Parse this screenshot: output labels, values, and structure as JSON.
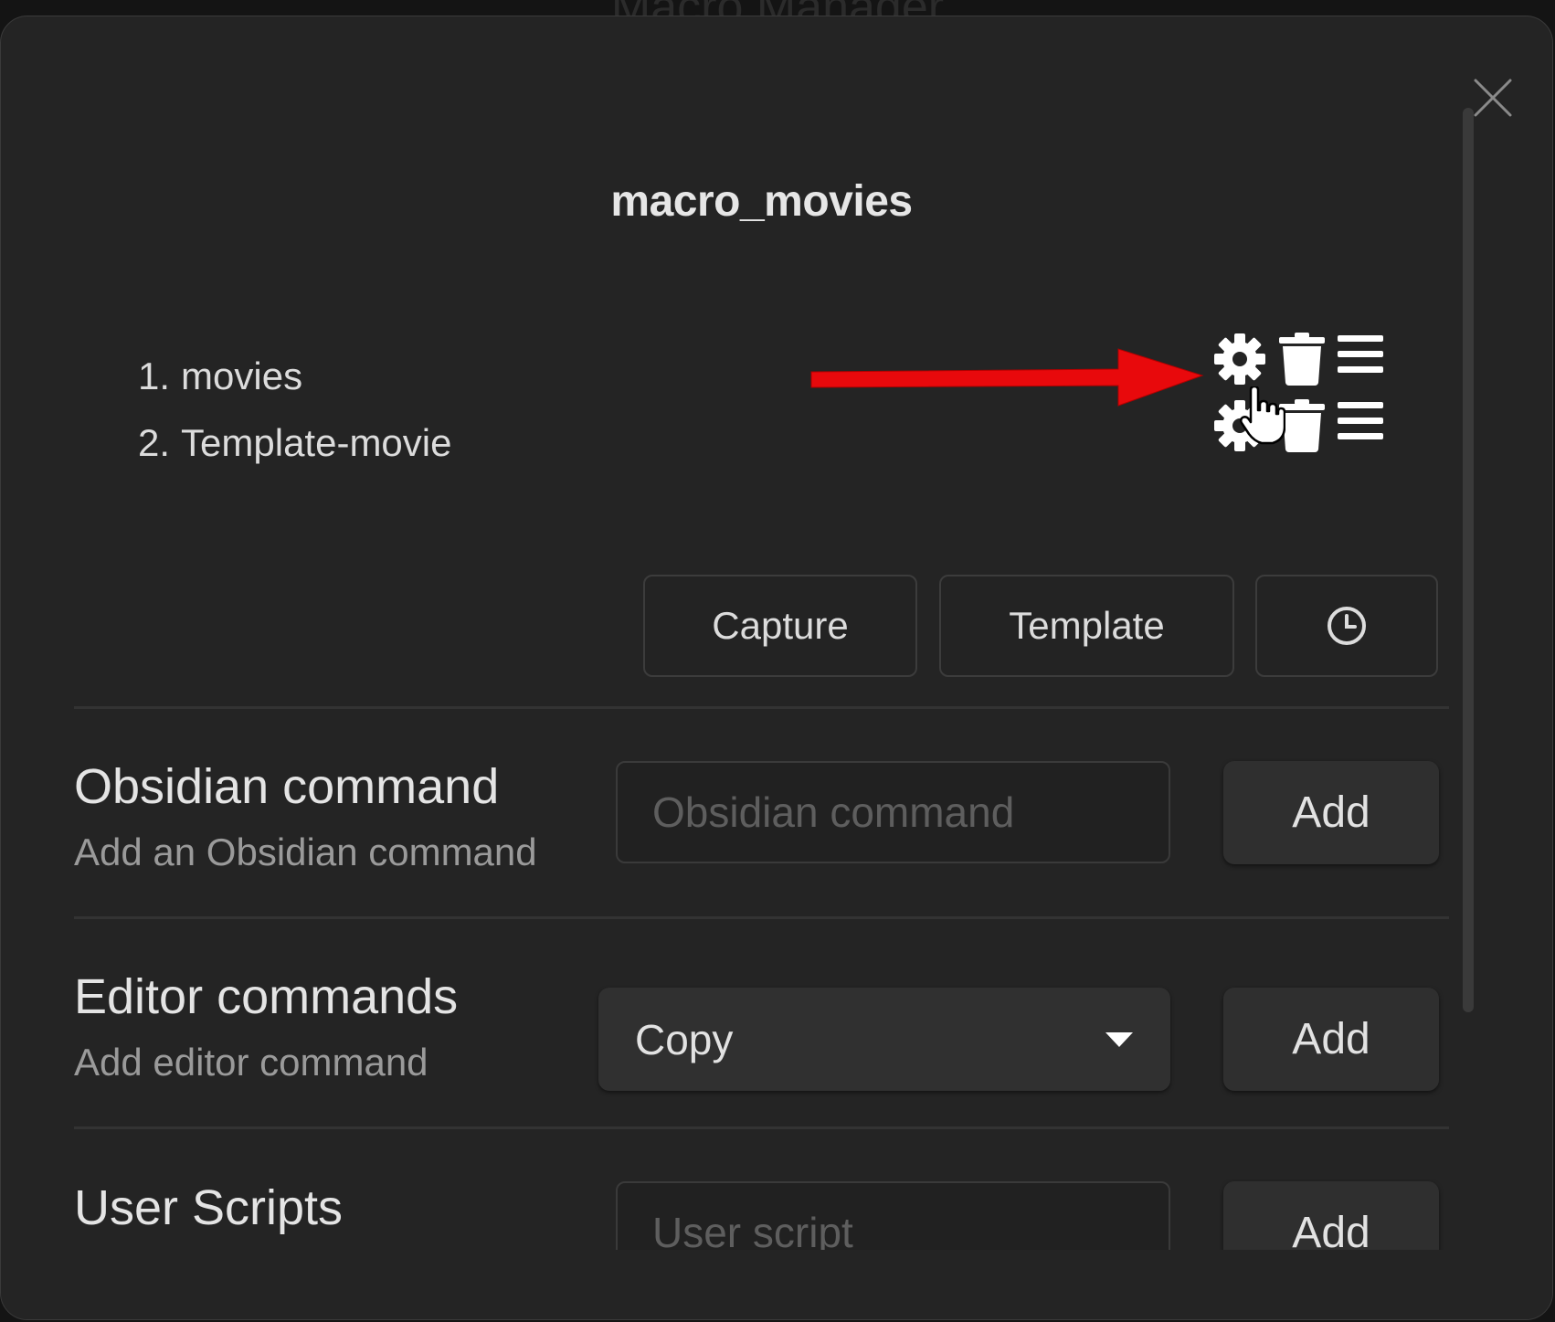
{
  "background": {
    "title": "Macro Manager"
  },
  "modal": {
    "close_icon": "close-icon",
    "title": "macro_movies"
  },
  "commands": [
    {
      "index": "1.",
      "name": "movies"
    },
    {
      "index": "2.",
      "name": "Template-movie"
    }
  ],
  "row_icons": [
    "gear-icon",
    "trash-icon",
    "drag-handle-icon"
  ],
  "add_choice_buttons": {
    "capture": "Capture",
    "template": "Template",
    "wait_icon": "clock-icon"
  },
  "settings": {
    "obsidian_command": {
      "name": "Obsidian command",
      "description": "Add an Obsidian command",
      "placeholder": "Obsidian command",
      "add_label": "Add"
    },
    "editor_commands": {
      "name": "Editor commands",
      "description": "Add editor command",
      "selected": "Copy",
      "add_label": "Add"
    },
    "user_scripts": {
      "name": "User Scripts",
      "placeholder": "User script",
      "add_label": "Add"
    }
  },
  "colors": {
    "annotation_arrow": "#e8090c",
    "background": "#242424"
  }
}
